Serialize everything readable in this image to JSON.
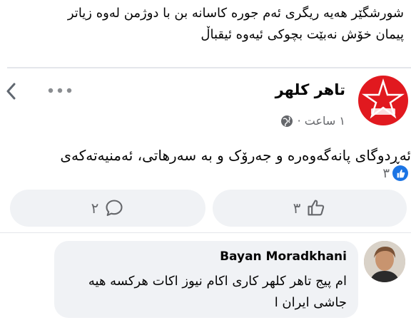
{
  "caption": {
    "line1": "شورشگێر  هەیە ریگری ئەم جورە کاسانە بن با دوژمن لەوە زیاتر",
    "line2": "پیمان خۆش نەبێت بچوکی ئیەوە ئیقباڵ"
  },
  "shared_post": {
    "page_name": "تاهر کلهر",
    "time": "١ ساعت ·",
    "body": "ئەڕدوگای پانەگەوەرە و جەرۆک و بە سەرهاتی، ئەمنیەتەکەی",
    "avatar_color": "#e1191f"
  },
  "reactions": {
    "count": "٣"
  },
  "actions": {
    "like_count": "٣",
    "comment_count": "٢"
  },
  "comment": {
    "author": "Bayan Moradkhani",
    "line1": "ام پیج تاهر کلهر کاری اکام نیوز اکات هرکسه هیه",
    "line2": "جاشی ایران ا"
  },
  "colors": {
    "accent": "#1b74e4",
    "bubble": "#f0f2f5",
    "secondary_text": "#65676b"
  }
}
